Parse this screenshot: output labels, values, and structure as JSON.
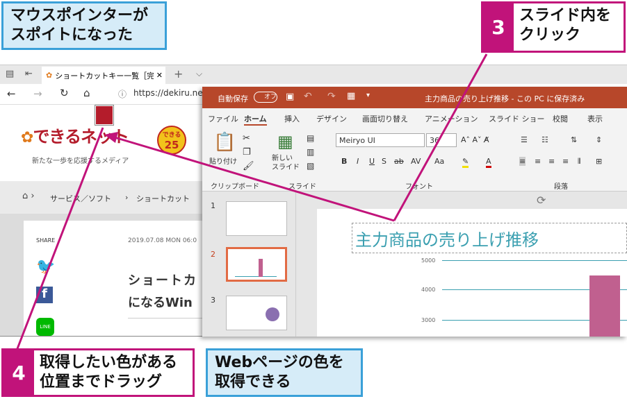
{
  "callouts": {
    "pointer_dropper": "マウスポインターが\nスポイトになった",
    "step3_num": "3",
    "step3_text": "スライド内を\nクリック",
    "step4_num": "4",
    "step4_text": "取得したい色がある\n位置までドラッグ",
    "web_color": "Webページの色を\n取得できる"
  },
  "browser": {
    "tab_title": "ショートカットキー一覧［完:",
    "url": "https://dekiru.net/",
    "site_logo": "できるネット",
    "site_tagline": "新たな一歩を応援するメディア",
    "breadcrumb": "サービス／ソフト",
    "breadcrumb_more": "ショートカット",
    "share_label": "SHARE",
    "date": "2019.07.08 MON 06:0",
    "headline_line1": "ショートカ",
    "headline_line2": "になるWin",
    "badge_top": "できる",
    "badge_num": "25",
    "line_label": "LINE"
  },
  "ppt": {
    "autosave": "自動保存",
    "autosave_state": "オフ",
    "doc_title": "主力商品の売り上げ推移 - この PC に保存済み",
    "tabs": [
      "ファイル",
      "ホーム",
      "挿入",
      "デザイン",
      "画面切り替え",
      "アニメーション",
      "スライド ショー",
      "校閲",
      "表示"
    ],
    "active_tab": "ホーム",
    "paste_label": "貼り付け",
    "new_slide_label": "新しい\nスライド",
    "font_name": "Meiryo UI",
    "font_size": "36",
    "groups": [
      "クリップボード",
      "スライド",
      "フォント",
      "段落"
    ],
    "slide_numbers": [
      "1",
      "2",
      "3"
    ],
    "slide_title": "主力商品の売り上げ推移",
    "y_ticks": [
      "5000",
      "4000",
      "3000"
    ]
  },
  "colors": {
    "accent_magenta": "#c1137a",
    "callout_blue": "#3aa0d8",
    "ppt_red": "#b7472a",
    "picked_color": "#b41c2b",
    "chart_bar": "#c0608f",
    "chart_line": "#3a9fb0"
  }
}
